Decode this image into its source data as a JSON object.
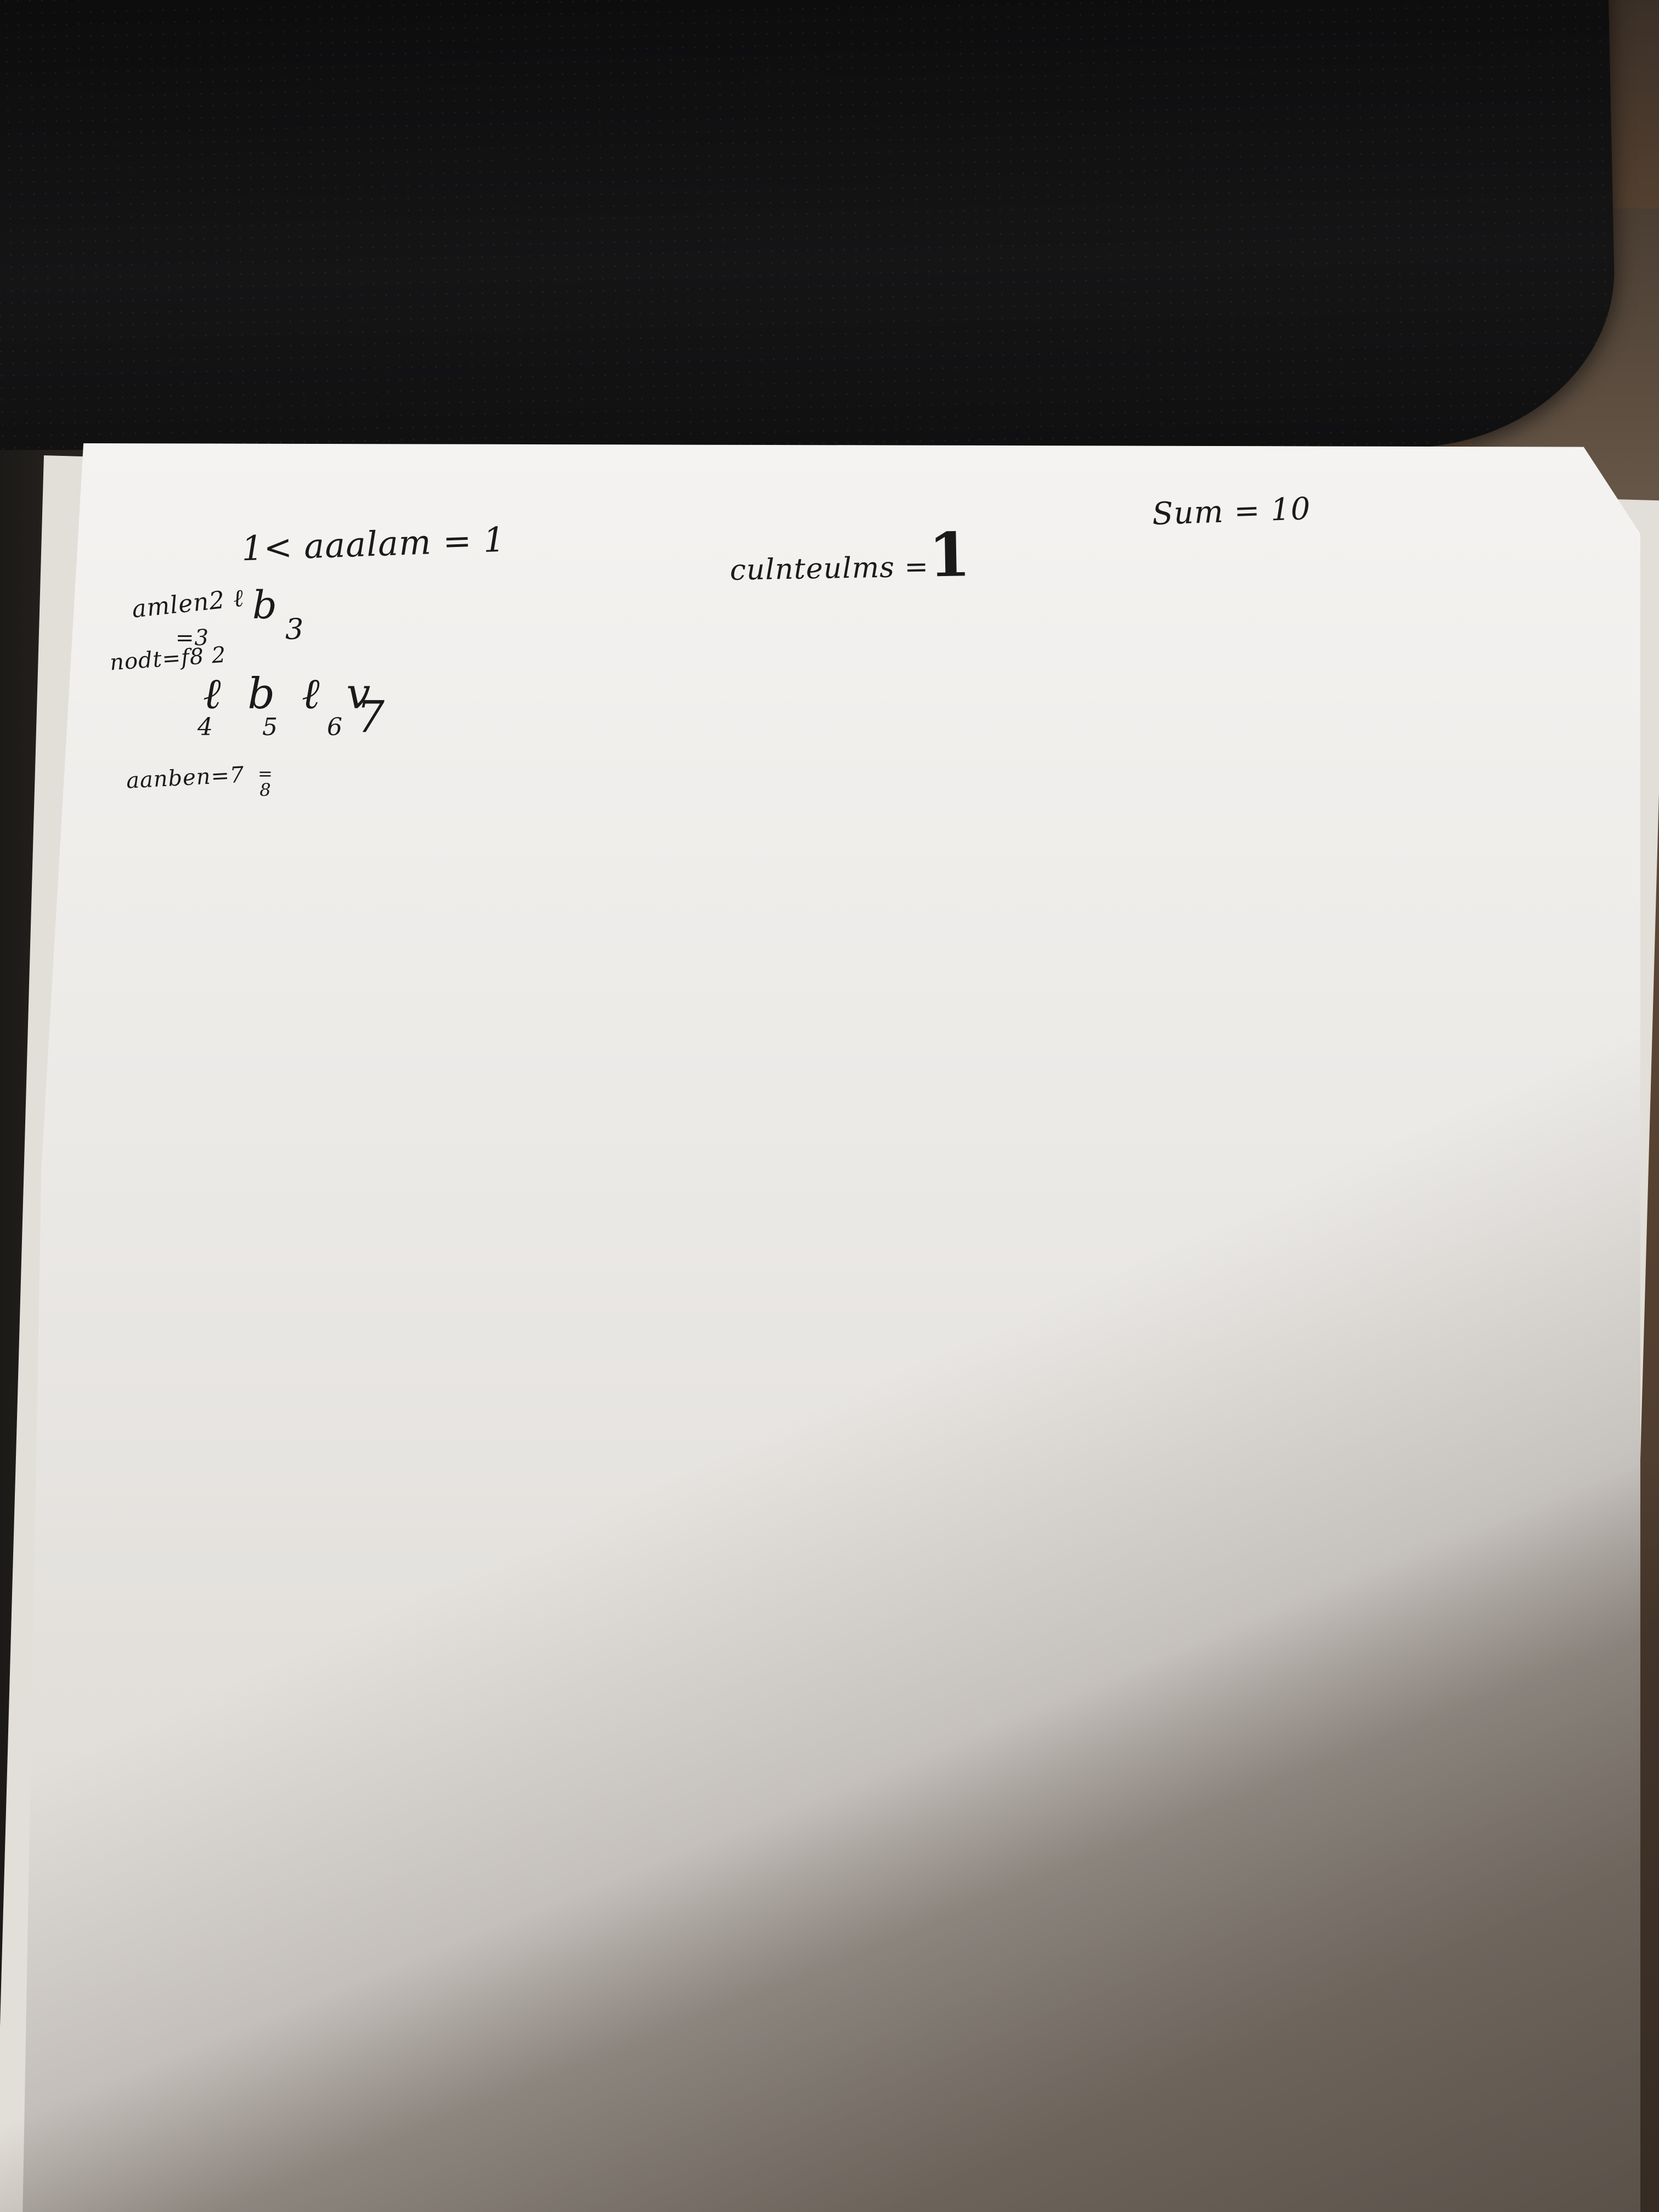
{
  "handwriting": {
    "top_left": "1< aaalam = 1",
    "top_middle": "culnteulms =",
    "top_middle_value": "1",
    "top_right": "Sum = 10",
    "left_line1": "amlen2 ℓ",
    "left_line2": "=3",
    "left_line3": "nodt=f8 2",
    "left_row_letters": "ℓ b ℓ v",
    "left_row_digits": "4 5 6",
    "left_bottom": "aanben=7",
    "branch_b": "b",
    "branch_3": "3",
    "seven": "7",
    "frac_top": "=",
    "frac_bottom": "8"
  }
}
